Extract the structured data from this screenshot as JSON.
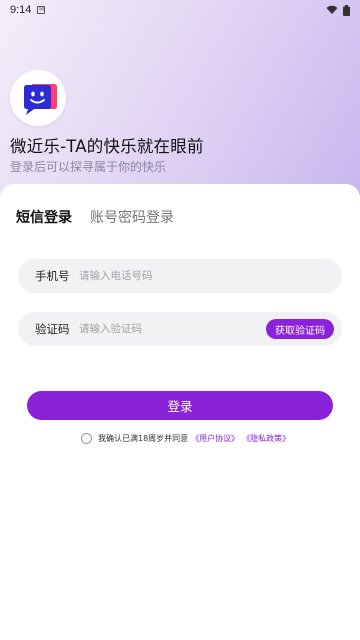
{
  "status_bar": {
    "time": "9:14"
  },
  "header": {
    "title": "微近乐-TA的快乐就在眼前",
    "subtitle": "登录后可以探寻属于你的快乐"
  },
  "tabs": [
    {
      "label": "短信登录",
      "active": true
    },
    {
      "label": "账号密码登录",
      "active": false
    }
  ],
  "form": {
    "phone_label": "手机号",
    "phone_placeholder": "请输入电话号码",
    "code_label": "验证码",
    "code_placeholder": "请输入验证码",
    "get_code_button": "获取验证码",
    "login_button": "登录"
  },
  "agreement": {
    "text": "我确认已满18周岁并同意",
    "user_agreement": "《用户协议》",
    "privacy_policy": "《隐私政策》"
  },
  "colors": {
    "accent": "#8a22d8",
    "logo_blue": "#2c2bd8",
    "logo_red": "#ff3c6e"
  },
  "icons": {
    "logo": "chat-bubble-face-icon",
    "wifi": "wifi-icon",
    "battery": "battery-icon"
  }
}
